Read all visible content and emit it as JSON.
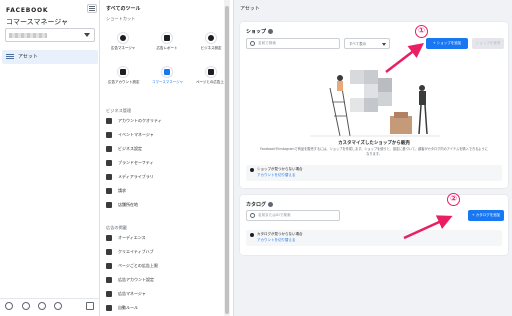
{
  "brand": "FACEBOOK",
  "app_name": "コマースマネージャ",
  "nav": {
    "asset_label": "アセット"
  },
  "menu": {
    "heading": "すべてのツール",
    "shortcuts_label": "ショートカット",
    "shortcuts": [
      {
        "label": "広告マネージャ"
      },
      {
        "label": "広告レポート"
      },
      {
        "label": "ビジネス設定"
      },
      {
        "label": "広告アカウント設定"
      },
      {
        "label": "コマースマネージャ"
      },
      {
        "label": "ページとの広告上限"
      }
    ],
    "business_label": "ビジネス管理",
    "business_items": [
      {
        "label": "アカウントのクオリティ"
      },
      {
        "label": "イベントマネージャ"
      },
      {
        "label": "ビジネス設定"
      },
      {
        "label": "ブランドセーフティ"
      },
      {
        "label": "メディアライブラリ"
      },
      {
        "label": "請求"
      },
      {
        "label": "店舗所在地"
      }
    ],
    "ads_label": "広告の掲載",
    "ads_items": [
      {
        "label": "オーディエンス"
      },
      {
        "label": "クリエイティブハブ"
      },
      {
        "label": "ページごとの広告上限"
      },
      {
        "label": "広告アカウント設定"
      },
      {
        "label": "広告マネージャ"
      },
      {
        "label": "自動ルール"
      }
    ]
  },
  "page_title": "アセット",
  "shop": {
    "title": "ショップ",
    "search_placeholder": "名前で検索",
    "filter_label": "すべて表示",
    "add_button": "+ ショップを追加",
    "disabled_button": "ショップを管理",
    "caption": "カスタマイズしたショップから販売",
    "description": "FacebookやInstagramで商品を販売するには、ショップを作成します。ショップを使うと、設定に基づいて、顧客がカタログ内のアイテムを購入できるようになります。",
    "notice_title": "ショップが見つからない場合",
    "notice_link": "アカウントを切り替える"
  },
  "catalog": {
    "title": "カタログ",
    "search_placeholder": "名前またはIDで検索",
    "add_button": "+ カタログを追加",
    "notice_title": "カタログが見つからない場合",
    "notice_link": "アカウントを切り替える"
  },
  "markers": {
    "one": "①",
    "two": "②"
  },
  "colors": {
    "accent": "#1877f2",
    "annotation": "#e91e63"
  }
}
